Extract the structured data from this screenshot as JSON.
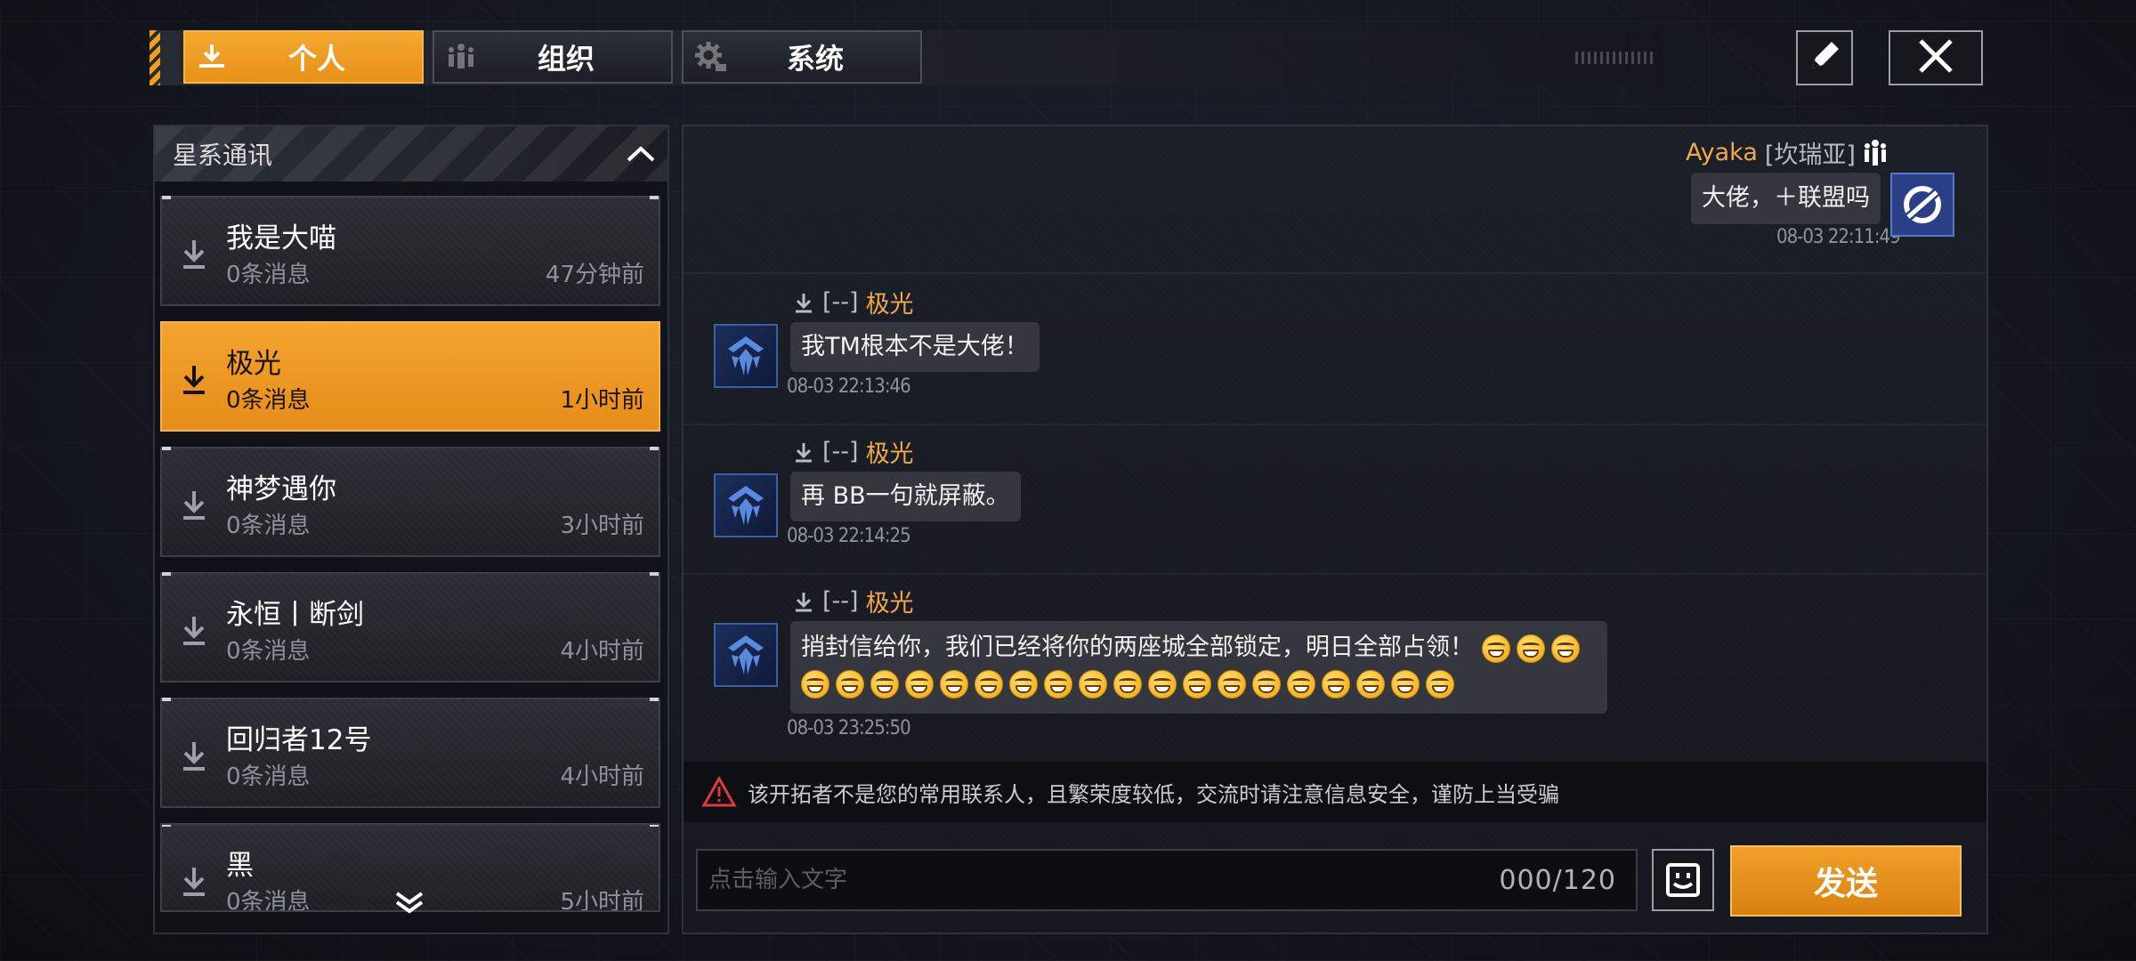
{
  "tabs": [
    {
      "label": "个人",
      "icon": "person-download-icon",
      "active": true
    },
    {
      "label": "组织",
      "icon": "group-icon",
      "active": false
    },
    {
      "label": "系统",
      "icon": "gear-icon",
      "active": false
    }
  ],
  "toolbar": {
    "edit_icon": "pencil-icon",
    "close_icon": "close-icon"
  },
  "left_panel": {
    "title": "星系通讯",
    "contacts": [
      {
        "name": "我是大喵",
        "messages": "0条消息",
        "time": "47分钟前",
        "selected": false
      },
      {
        "name": "极光",
        "messages": "0条消息",
        "time": "1小时前",
        "selected": true
      },
      {
        "name": "神梦遇你",
        "messages": "0条消息",
        "time": "3小时前",
        "selected": false
      },
      {
        "name": "永恒丨断剑",
        "messages": "0条消息",
        "time": "4小时前",
        "selected": false
      },
      {
        "name": "回归者12号",
        "messages": "0条消息",
        "time": "4小时前",
        "selected": false
      },
      {
        "name": "黑",
        "messages": "0条消息",
        "time": "5小时前",
        "selected": false
      }
    ]
  },
  "chat": {
    "self_message": {
      "sender": "Ayaka",
      "tag": "[坎瑞亚]",
      "text": "大佬，＋联盟吗",
      "time": "08-03 22:11:49"
    },
    "messages": [
      {
        "prefix": "[--]",
        "sender": "极光",
        "text": "我TM根本不是大佬！",
        "time": "08-03 22:13:46"
      },
      {
        "prefix": "[--]",
        "sender": "极光",
        "text": "再 BB一句就屏蔽。",
        "time": "08-03 22:14:25"
      },
      {
        "prefix": "[--]",
        "sender": "极光",
        "text": "捎封信给你，我们已经将你的两座城全部锁定，明日全部占领！",
        "emoji_count": 22,
        "emoji_name": "grinning-face-emoji",
        "time": "08-03 23:25:50"
      }
    ],
    "warning": "该开拓者不是您的常用联系人，且繁荣度较低，交流时请注意信息安全，谨防上当受骗",
    "input": {
      "placeholder": "点击输入文字",
      "value": "",
      "char_count": "000/120"
    },
    "send_label": "发送"
  },
  "colors": {
    "accent": "#f0a02a",
    "sender_name": "#f0a84a",
    "avatar_blue": "#2a3f86"
  }
}
